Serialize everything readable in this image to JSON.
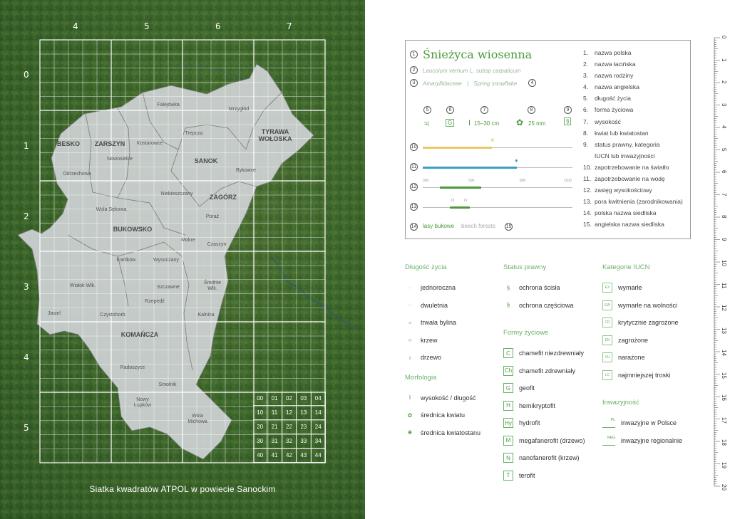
{
  "map": {
    "grid_columns": [
      "4",
      "5",
      "6",
      "7"
    ],
    "grid_rows": [
      "0",
      "1",
      "2",
      "3",
      "4",
      "5"
    ],
    "caption": "Siatka kwadratów ATPOL w powiecie Sanockim",
    "regions": [
      "BESKO",
      "ZARSZYN",
      "SANOK",
      "TYRAWA WOŁOSKA",
      "ZAGÓRZ",
      "BUKOWSKO",
      "KOMAŃCZA"
    ],
    "places": [
      "Falejówka",
      "Mrzygłód",
      "Kostarowce",
      "Trepcza",
      "Nowosielce",
      "Odrzechowa",
      "Bykowce",
      "Niebieszczany",
      "Wola Sękowa",
      "Poraź",
      "Mokre",
      "Czaszyn",
      "Karlików",
      "Wysoczany",
      "Wisłok Wlk.",
      "Szczawne",
      "Średnie Wlk.",
      "Rzepedź",
      "Jasiel",
      "Czystohorb",
      "Kalnica",
      "Radoszyce",
      "Smolnik",
      "Nowy Łupków",
      "Wola Michowa"
    ],
    "key_cells": [
      "00",
      "01",
      "02",
      "03",
      "04",
      "10",
      "11",
      "12",
      "13",
      "14",
      "20",
      "21",
      "22",
      "23",
      "24",
      "30",
      "31",
      "32",
      "33",
      "34",
      "40",
      "41",
      "42",
      "43",
      "44"
    ]
  },
  "card": {
    "markers": [
      "1",
      "2",
      "3",
      "4",
      "5",
      "6",
      "7",
      "8",
      "9",
      "10",
      "11",
      "12",
      "13",
      "14",
      "15"
    ],
    "name_pl": "Śnieżyca wiosenna",
    "name_latin": "Leucoium vernum L. subsp carpaticum",
    "family": "Amaryllidaceae",
    "separator": "|",
    "name_en": "Spring snowflake",
    "lifespan_symbol": "♃",
    "form_symbol": "G",
    "height": "15–30 cm",
    "flower_size": "25 mm",
    "status_symbol": "§",
    "light_icon": "☀",
    "water_icon": "♦",
    "altitude_ticks": [
      "300",
      "500",
      "800",
      "1100"
    ],
    "bloom_ticks": [
      "III",
      "IV"
    ],
    "habitat_pl": "lasy bukowe",
    "habitat_en": "beech forests",
    "light_fraction": 0.46,
    "water_fraction": 0.63,
    "colors": {
      "light": "#e8c96a",
      "water": "#3aa0c8",
      "green": "#4a9a3a"
    }
  },
  "key_list": [
    {
      "n": "1.",
      "t": "nazwa polska"
    },
    {
      "n": "2.",
      "t": "nazwa łacińska"
    },
    {
      "n": "3.",
      "t": "nazwa rodziny"
    },
    {
      "n": "4.",
      "t": "nazwa angielska"
    },
    {
      "n": "5.",
      "t": "długość życia"
    },
    {
      "n": "6.",
      "t": "forma życiowa"
    },
    {
      "n": "7.",
      "t": "wysokość"
    },
    {
      "n": "8.",
      "t": "kwiat lub kwiatostan"
    },
    {
      "n": "9.",
      "t": "status prawny, kategoria"
    },
    {
      "n": "",
      "t": "IUCN lub inwazyjności"
    },
    {
      "n": "10.",
      "t": "zapotrzebowanie na światło"
    },
    {
      "n": "11.",
      "t": "zapotrzebowanie na wodę"
    },
    {
      "n": "12.",
      "t": "zasięg wysokościowy"
    },
    {
      "n": "13.",
      "t": "pora kwitnienia (zarodnikowania)"
    },
    {
      "n": "14.",
      "t": "polska nazwa siedliska"
    },
    {
      "n": "15.",
      "t": "angielska nazwa siedliska"
    }
  ],
  "legend": {
    "lifespan": {
      "title": "Długość życia",
      "items": [
        {
          "icon": "annual-icon",
          "sym": "·",
          "label": "jednoroczna"
        },
        {
          "icon": "biennial-icon",
          "sym": "··",
          "label": "dwuletnia"
        },
        {
          "icon": "perennial-icon",
          "sym": "♃",
          "label": "trwała bylina"
        },
        {
          "icon": "shrub-icon",
          "sym": "○",
          "label": "krzew"
        },
        {
          "icon": "tree-icon",
          "sym": "♁",
          "label": "drzewo"
        }
      ]
    },
    "morphology": {
      "title": "Morfologia",
      "items": [
        {
          "icon": "height-icon",
          "sym": "I",
          "label": "wysokość / długość"
        },
        {
          "icon": "flower-icon",
          "sym": "✿",
          "label": "średnica kwiatu"
        },
        {
          "icon": "inflorescence-icon",
          "sym": "❀",
          "label": "średnica kwiatostanu"
        }
      ]
    },
    "status": {
      "title": "Status prawny",
      "items": [
        {
          "icon": "strict-protection-icon",
          "sym": "§",
          "label": "ochrona ścisła"
        },
        {
          "icon": "partial-protection-icon",
          "sym": "§",
          "label": "ochrona częściowa"
        }
      ]
    },
    "forms": {
      "title": "Formy życiowe",
      "items": [
        {
          "sym": "C",
          "label": "chamefit niezdrewniały"
        },
        {
          "sym": "Ch",
          "label": "chamefit zdrewniały"
        },
        {
          "sym": "G",
          "label": "geofit"
        },
        {
          "sym": "H",
          "label": "hemikryptofit"
        },
        {
          "sym": "Hy",
          "label": "hydrofit"
        },
        {
          "sym": "M",
          "label": "megafanerofit (drzewo)"
        },
        {
          "sym": "N",
          "label": "nanofanerofit (krzew)"
        },
        {
          "sym": "T",
          "label": "terofit"
        }
      ]
    },
    "iucn": {
      "title": "Kategorie IUCN",
      "items": [
        {
          "sym": "EX",
          "label": "wymarłe"
        },
        {
          "sym": "EW",
          "label": "wymarłe na wolności"
        },
        {
          "sym": "CR",
          "label": "krytycznie zagrożone"
        },
        {
          "sym": "EN",
          "label": "zagrożone"
        },
        {
          "sym": "VU",
          "label": "narażone"
        },
        {
          "sym": "LC",
          "label": "najmniejszej troski"
        }
      ]
    },
    "invasive": {
      "title": "Inwazyjność",
      "items": [
        {
          "sym": "PL",
          "label": "inwazyjne w Polsce"
        },
        {
          "sym": "REG",
          "label": "inwazyjne regionalnie"
        }
      ]
    }
  },
  "ruler": [
    "0",
    "1",
    "2",
    "3",
    "4",
    "5",
    "6",
    "7",
    "8",
    "9",
    "10",
    "11",
    "12",
    "13",
    "14",
    "15",
    "16",
    "17",
    "18",
    "19",
    "20"
  ]
}
